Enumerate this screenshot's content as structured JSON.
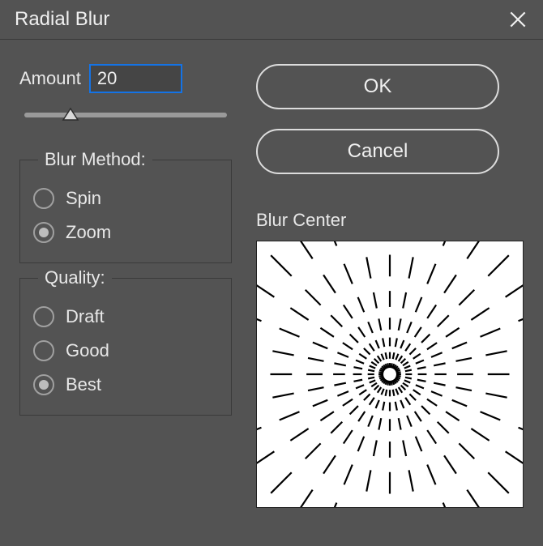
{
  "title": "Radial Blur",
  "amount": {
    "label": "Amount",
    "value": "20",
    "min": 0,
    "max": 100
  },
  "buttons": {
    "ok": "OK",
    "cancel": "Cancel"
  },
  "blurMethod": {
    "legend": "Blur Method:",
    "options": [
      {
        "label": "Spin",
        "selected": false
      },
      {
        "label": "Zoom",
        "selected": true
      }
    ]
  },
  "quality": {
    "legend": "Quality:",
    "options": [
      {
        "label": "Draft",
        "selected": false
      },
      {
        "label": "Good",
        "selected": false
      },
      {
        "label": "Best",
        "selected": true
      }
    ]
  },
  "blurCenter": {
    "label": "Blur Center",
    "cx": 0.5,
    "cy": 0.5
  }
}
